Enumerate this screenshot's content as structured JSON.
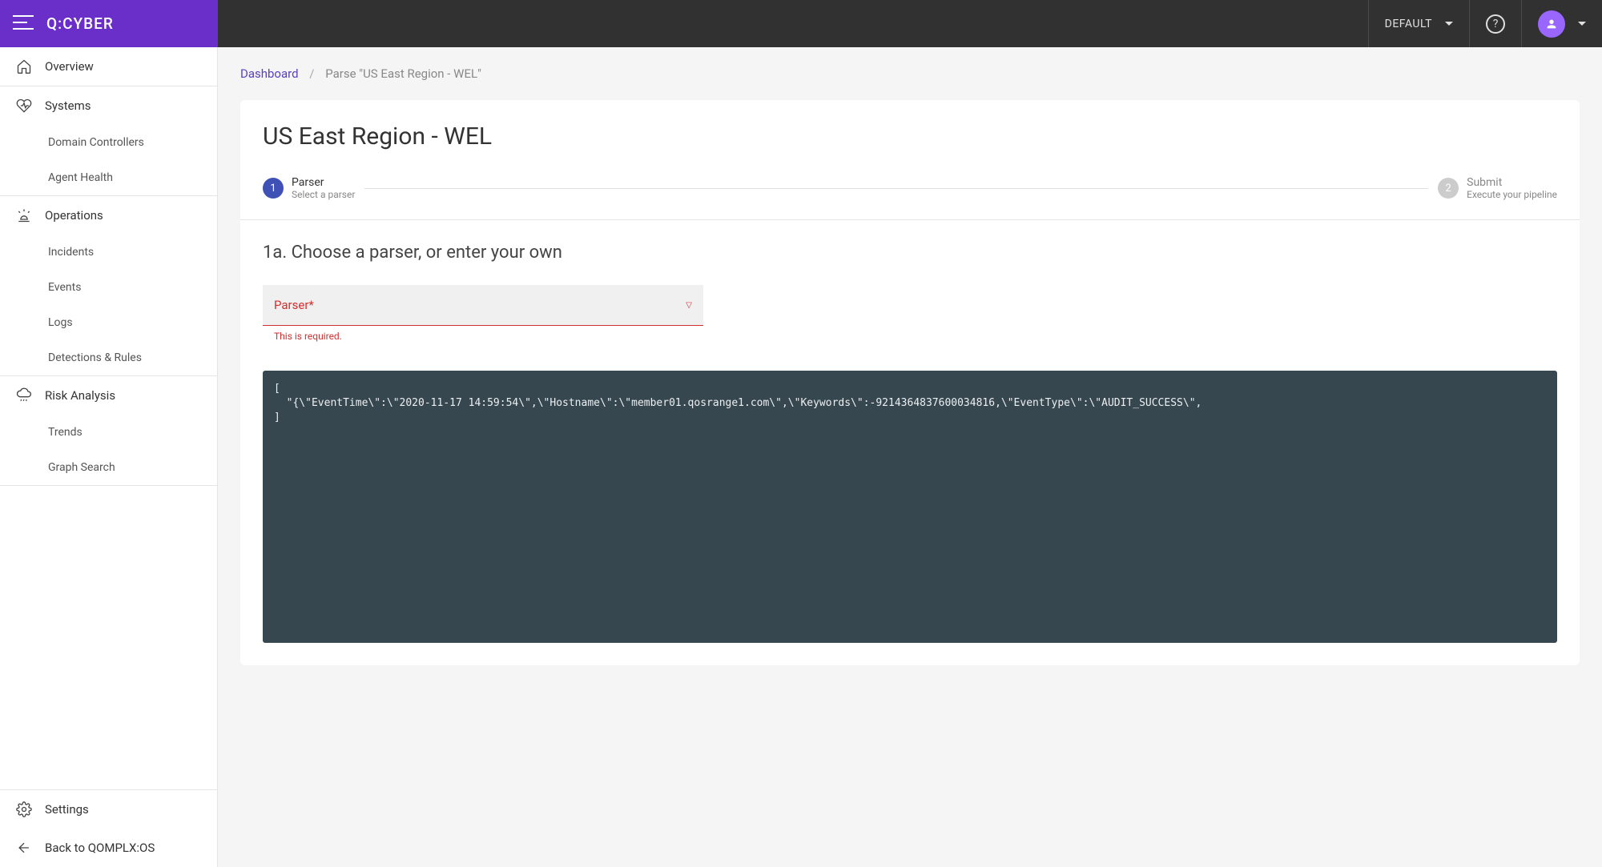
{
  "brand": "Q:CYBER",
  "header": {
    "tenant_label": "DEFAULT"
  },
  "sidebar": {
    "groups": [
      {
        "icon": "home",
        "label": "Overview",
        "children": []
      },
      {
        "icon": "heartbeat",
        "label": "Systems",
        "children": [
          "Domain Controllers",
          "Agent Health"
        ]
      },
      {
        "icon": "siren",
        "label": "Operations",
        "children": [
          "Incidents",
          "Events",
          "Logs",
          "Detections & Rules"
        ]
      },
      {
        "icon": "cloud-rain",
        "label": "Risk Analysis",
        "children": [
          "Trends",
          "Graph Search"
        ]
      }
    ],
    "bottom": [
      {
        "icon": "gear",
        "label": "Settings"
      },
      {
        "icon": "back-arrow",
        "label": "Back to QOMPLX:OS"
      }
    ]
  },
  "breadcrumb": {
    "root": "Dashboard",
    "current": "Parse \"US East Region - WEL\""
  },
  "page_title": "US East Region - WEL",
  "stepper": {
    "steps": [
      {
        "num": "1",
        "title": "Parser",
        "subtitle": "Select a parser",
        "active": true
      },
      {
        "num": "2",
        "title": "Submit",
        "subtitle": "Execute your pipeline",
        "active": false
      }
    ]
  },
  "section": {
    "title": "1a. Choose a parser, or enter your own"
  },
  "parser_select": {
    "label": "Parser*",
    "error": "This is required."
  },
  "code_preview": "[\n  \"{\\\"EventTime\\\":\\\"2020-11-17 14:59:54\\\",\\\"Hostname\\\":\\\"member01.qosrange1.com\\\",\\\"Keywords\\\":-9214364837600034816,\\\"EventType\\\":\\\"AUDIT_SUCCESS\\\",\n]"
}
